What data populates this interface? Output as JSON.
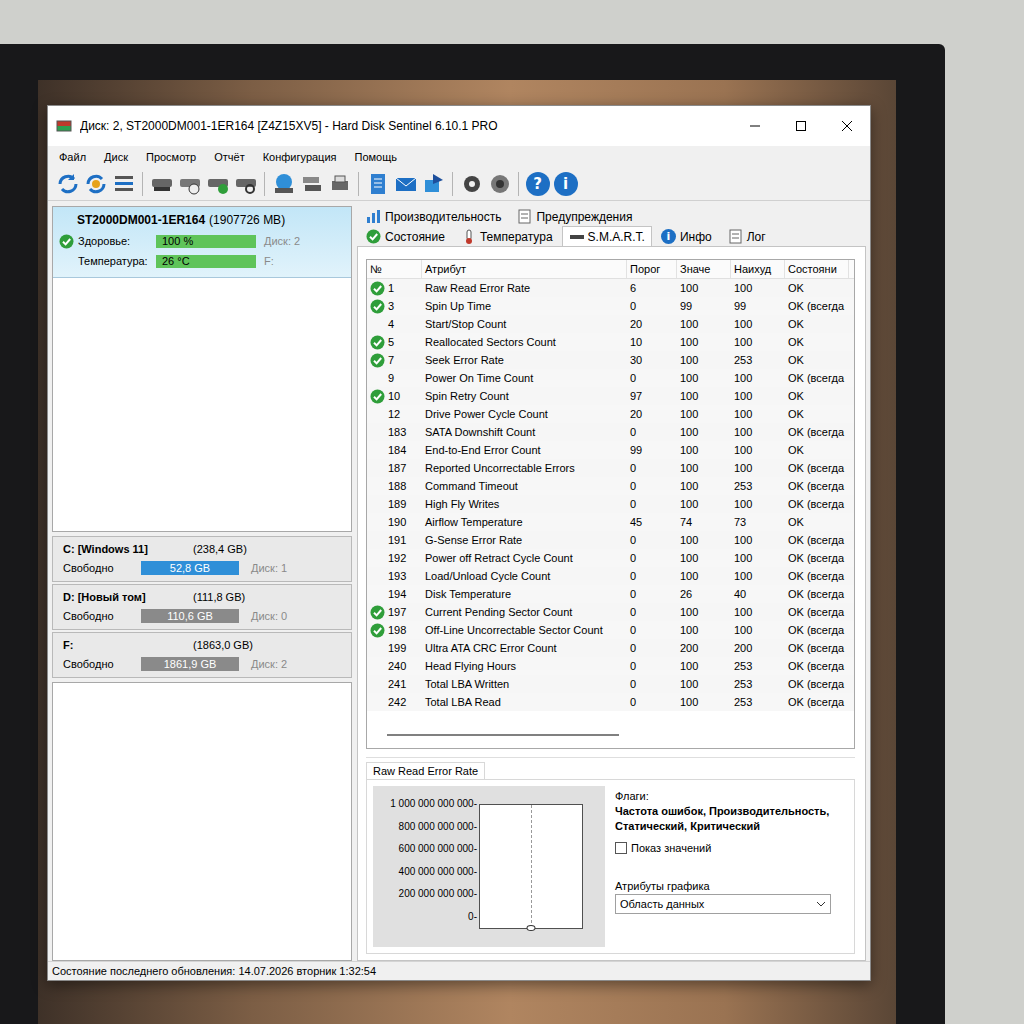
{
  "window": {
    "title": "Диск: 2, ST2000DM001-1ER164 [Z4Z15XV5]  -  Hard Disk Sentinel 6.10.1 PRO"
  },
  "menu": [
    "Файл",
    "Диск",
    "Просмотр",
    "Отчёт",
    "Конфигурация",
    "Помощь"
  ],
  "toolbar": {
    "help_glyph": "?",
    "info_glyph": "i"
  },
  "disk": {
    "name": "ST2000DM001-1ER164",
    "size": "(1907726 MB)",
    "selected": true,
    "health": {
      "label": "Здоровье:",
      "value": "100 %",
      "level": 1,
      "aux": "Диск: 2"
    },
    "temperature": {
      "label": "Температура:",
      "value": "26 °C",
      "level": 1,
      "aux": "F:"
    }
  },
  "volumes": [
    {
      "name": "C: [Windows 11]",
      "size": "(238,4 GB)",
      "free_label": "Свободно",
      "free": "52,8 GB",
      "level": 1,
      "disk": "Диск: 1",
      "color": "#2f8fd8"
    },
    {
      "name": "D: [Новый том]",
      "size": "(111,8 GB)",
      "free_label": "Свободно",
      "free": "110,6 GB",
      "level": 1,
      "disk": "Диск: 0",
      "color": "#8a8a8a"
    },
    {
      "name": "F:",
      "size": "(1863,0 GB)",
      "free_label": "Свободно",
      "free": "1861,9 GB",
      "level": 1,
      "disk": "Диск: 2",
      "color": "#8a8a8a"
    }
  ],
  "tabs_top": [
    {
      "label": "Производительность",
      "selected": false
    },
    {
      "label": "Предупреждения",
      "selected": false
    }
  ],
  "tabs": [
    {
      "label": "Состояние",
      "selected": false
    },
    {
      "label": "Температура",
      "selected": false
    },
    {
      "label": "S.M.A.R.T.",
      "selected": true
    },
    {
      "label": "Инфо",
      "selected": false,
      "glyph": "i"
    },
    {
      "label": "Лог",
      "selected": false
    }
  ],
  "table": {
    "columns": [
      "№",
      "Атрибут",
      "Порог",
      "Значе",
      "Наихуд",
      "Состояни"
    ],
    "rows": [
      {
        "cells": [
          "1",
          "Raw Read Error Rate",
          "6",
          "100",
          "100",
          "OK"
        ],
        "check": true
      },
      {
        "cells": [
          "3",
          "Spin Up Time",
          "0",
          "99",
          "99",
          "OK (всегда"
        ],
        "check": true
      },
      {
        "cells": [
          "4",
          "Start/Stop Count",
          "20",
          "100",
          "100",
          "OK"
        ],
        "check": false
      },
      {
        "cells": [
          "5",
          "Reallocated Sectors Count",
          "10",
          "100",
          "100",
          "OK"
        ],
        "check": true
      },
      {
        "cells": [
          "7",
          "Seek Error Rate",
          "30",
          "100",
          "253",
          "OK"
        ],
        "check": true
      },
      {
        "cells": [
          "9",
          "Power On Time Count",
          "0",
          "100",
          "100",
          "OK (всегда"
        ],
        "check": false
      },
      {
        "cells": [
          "10",
          "Spin Retry Count",
          "97",
          "100",
          "100",
          "OK"
        ],
        "check": true
      },
      {
        "cells": [
          "12",
          "Drive Power Cycle Count",
          "20",
          "100",
          "100",
          "OK"
        ],
        "check": false
      },
      {
        "cells": [
          "183",
          "SATA Downshift Count",
          "0",
          "100",
          "100",
          "OK (всегда"
        ],
        "check": false
      },
      {
        "cells": [
          "184",
          "End-to-End Error Count",
          "99",
          "100",
          "100",
          "OK"
        ],
        "check": false
      },
      {
        "cells": [
          "187",
          "Reported Uncorrectable Errors",
          "0",
          "100",
          "100",
          "OK (всегда"
        ],
        "check": false
      },
      {
        "cells": [
          "188",
          "Command Timeout",
          "0",
          "100",
          "253",
          "OK (всегда"
        ],
        "check": false
      },
      {
        "cells": [
          "189",
          "High Fly Writes",
          "0",
          "100",
          "100",
          "OK (всегда"
        ],
        "check": false
      },
      {
        "cells": [
          "190",
          "Airflow Temperature",
          "45",
          "74",
          "73",
          "OK"
        ],
        "check": false
      },
      {
        "cells": [
          "191",
          "G-Sense Error Rate",
          "0",
          "100",
          "100",
          "OK (всегда"
        ],
        "check": false
      },
      {
        "cells": [
          "192",
          "Power off Retract Cycle Count",
          "0",
          "100",
          "100",
          "OK (всегда"
        ],
        "check": false
      },
      {
        "cells": [
          "193",
          "Load/Unload Cycle Count",
          "0",
          "100",
          "100",
          "OK (всегда"
        ],
        "check": false
      },
      {
        "cells": [
          "194",
          "Disk Temperature",
          "0",
          "26",
          "40",
          "OK (всегда"
        ],
        "check": false
      },
      {
        "cells": [
          "197",
          "Current Pending Sector Count",
          "0",
          "100",
          "100",
          "OK (всегда"
        ],
        "check": true
      },
      {
        "cells": [
          "198",
          "Off-Line Uncorrectable Sector Count",
          "0",
          "100",
          "100",
          "OK (всегда"
        ],
        "check": true
      },
      {
        "cells": [
          "199",
          "Ultra ATA CRC Error Count",
          "0",
          "200",
          "200",
          "OK (всегда"
        ],
        "check": false
      },
      {
        "cells": [
          "240",
          "Head Flying Hours",
          "0",
          "100",
          "253",
          "OK (всегда"
        ],
        "check": false
      },
      {
        "cells": [
          "241",
          "Total LBA Written",
          "0",
          "100",
          "253",
          "OK (всегда"
        ],
        "check": false
      },
      {
        "cells": [
          "242",
          "Total LBA Read",
          "0",
          "100",
          "253",
          "OK (всегда"
        ],
        "check": false
      }
    ]
  },
  "chart": {
    "tab": "Raw Read Error Rate",
    "y_ticks": [
      "1 000 000 000 000",
      "800 000 000 000",
      "600 000 000 000",
      "400 000 000 000",
      "200 000 000 000",
      "0"
    ],
    "y_max": 1000000000000,
    "series": [
      {
        "values": [
          0
        ]
      }
    ]
  },
  "flags": {
    "label": "Флаги:",
    "text": "Частота ошибок, Производительность, Статический, Критический"
  },
  "show_values": {
    "label": "Показ значений",
    "checked": false
  },
  "graph_attrs": {
    "label": "Атрибуты графика",
    "value": "Область данных"
  },
  "status_bar": "Состояние последнего обновления: 14.07.2026 вторник 1:32:54"
}
